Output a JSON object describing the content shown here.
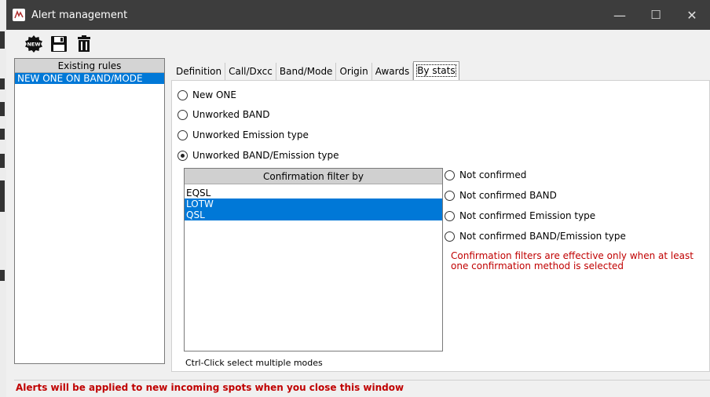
{
  "window": {
    "title": "Alert management",
    "controls": {
      "minimize": "—",
      "maximize": "☐",
      "close": "✕"
    }
  },
  "toolbar": {
    "new_badge": "NEW",
    "icons": [
      "new-icon",
      "save-icon",
      "trash-icon"
    ]
  },
  "rules": {
    "header": "Existing rules",
    "items": [
      "NEW ONE ON BAND/MODE"
    ],
    "selected_index": 0
  },
  "tabs": [
    "Definition",
    "Call/Dxcc",
    "Band/Mode",
    "Origin",
    "Awards",
    "By stats"
  ],
  "active_tab": "By stats",
  "stats_options": [
    {
      "label": "New ONE",
      "checked": false
    },
    {
      "label": "Unworked BAND",
      "checked": false
    },
    {
      "label": "Unworked Emission type",
      "checked": false
    },
    {
      "label": "Unworked BAND/Emission type",
      "checked": true
    }
  ],
  "confirmation": {
    "header": "Confirmation filter by",
    "items": [
      {
        "label": "EQSL",
        "selected": false
      },
      {
        "label": "LOTW",
        "selected": true
      },
      {
        "label": "QSL",
        "selected": true
      }
    ],
    "options": [
      {
        "label": "Not confirmed",
        "checked": false
      },
      {
        "label": "Not confirmed BAND",
        "checked": false
      },
      {
        "label": "Not confirmed Emission type",
        "checked": false
      },
      {
        "label": "Not confirmed BAND/Emission type",
        "checked": false
      }
    ],
    "warning": "Confirmation filters are effective only when at least one confirmation method is selected",
    "hint": "Ctrl-Click select multiple modes"
  },
  "status": "Alerts will be applied to new incoming spots when you close this window",
  "colors": {
    "accent": "#0078d7",
    "warning": "#c00000",
    "titlebar": "#3d3d3d"
  }
}
